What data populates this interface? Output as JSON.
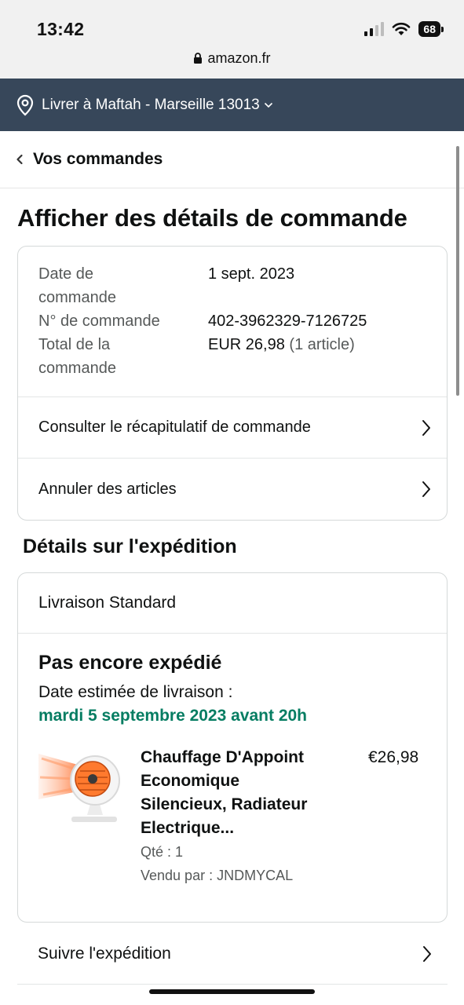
{
  "status_bar": {
    "time": "13:42",
    "battery": "68",
    "url": "amazon.fr"
  },
  "deliver_bar": {
    "label": "Livrer à Maftah - Marseille 13013",
    "icon": "location-pin-icon"
  },
  "back_nav": {
    "label": "Vos commandes"
  },
  "page": {
    "title": "Afficher des détails de commande"
  },
  "order": {
    "date_label_l1": "Date de",
    "date_label_l2": "commande",
    "date_value": "1 sept. 2023",
    "number_label": "N° de commande",
    "number_value": "402-3962329-7126725",
    "total_label_l1": "Total de la",
    "total_label_l2": "commande",
    "total_value": "EUR 26,98",
    "total_count": "(1 article)"
  },
  "links": {
    "summary": "Consulter le récapitulatif de commande",
    "cancel": "Annuler des articles",
    "track": "Suivre l'expédition"
  },
  "shipping": {
    "section_title": "Détails sur l'expédition",
    "method": "Livraison Standard",
    "status": "Pas encore expédié",
    "estimate_label": "Date estimée de livraison :",
    "estimate_date": "mardi 5 septembre 2023 avant 20h"
  },
  "item": {
    "title_l1": "Chauffage D'Appoint",
    "title_l2": "Economique",
    "title_l3": "Silencieux, Radiateur",
    "title_l4": "Electrique...",
    "qty": "Qté : 1",
    "seller": "Vendu par : JNDMYCAL",
    "price": "€26,98"
  },
  "colors": {
    "deliver_bar_bg": "#37475a",
    "estimate_green": "#067d62",
    "muted_text": "#565959"
  }
}
